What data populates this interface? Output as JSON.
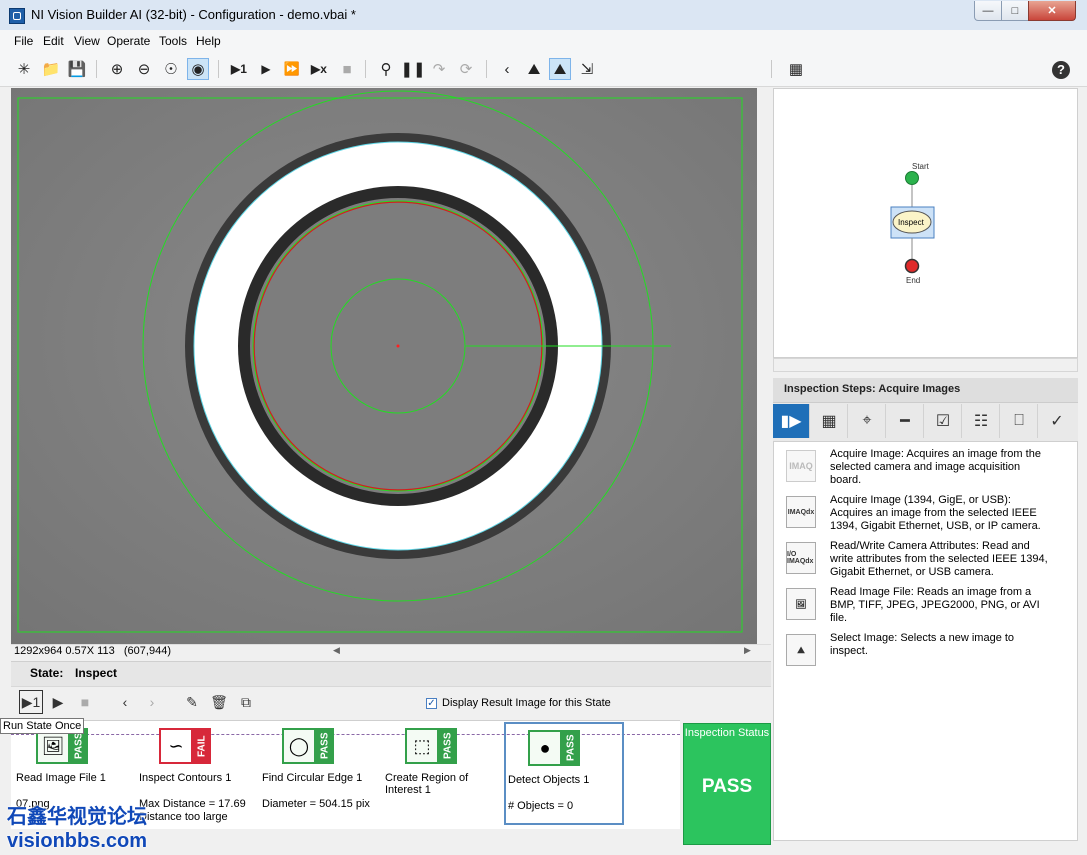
{
  "window": {
    "title": "NI Vision Builder AI (32-bit) - Configuration - demo.vbai *"
  },
  "menu": [
    "File",
    "Edit",
    "View",
    "Operate",
    "Tools",
    "Help"
  ],
  "toolbar": {
    "new_icon": "new-icon",
    "open_icon": "folder-icon",
    "save_icon": "save-icon",
    "zoom_in_icon": "zoom-in-icon",
    "zoom_out_icon": "zoom-out-icon",
    "zoom_11_icon": "zoom-1-1-icon",
    "zoom_fit_icon": "zoom-fit-icon",
    "run_once_glyph": "▶1",
    "run_glyph": "▶",
    "run_cont_glyph": "⏩",
    "run_x_glyph": "▶x"
  },
  "viewer": {
    "image_info": "1292x964 0.57X 113",
    "coords": "(607,944)"
  },
  "state": {
    "label": "State:",
    "value": "Inspect"
  },
  "display_result": {
    "checked": true,
    "label": "Display Result Image for this State"
  },
  "tooltip": "Run State Once",
  "steps": [
    {
      "name": "Read Image File 1",
      "status": "PASS",
      "result1": "07.png",
      "result2": ""
    },
    {
      "name": "Inspect Contours 1",
      "status": "FAIL",
      "result1": "Max Distance = 17.69",
      "result2": "Distance too large"
    },
    {
      "name": "Find Circular Edge 1",
      "status": "PASS",
      "result1": "Diameter = 504.15 pix",
      "result2": ""
    },
    {
      "name": "Create Region of Interest 1",
      "status": "PASS",
      "result1": "",
      "result2": ""
    },
    {
      "name": "Detect Objects 1",
      "status": "PASS",
      "result1": "# Objects = 0",
      "result2": ""
    }
  ],
  "inspection_status": {
    "title": "Inspection Status",
    "value": "PASS"
  },
  "flow": {
    "start_label": "Start",
    "inspect_label": "Inspect",
    "end_label": "End"
  },
  "inspection_steps": {
    "title": "Inspection Steps: Acquire Images",
    "items": [
      {
        "icon_text": "IMAQ",
        "text": "Acquire Image:  Acquires an image from the selected camera and image acquisition board."
      },
      {
        "icon_text": "IMAQdx",
        "text": "Acquire Image (1394, GigE, or USB):  Acquires an image from the selected IEEE 1394, Gigabit Ethernet, USB, or IP camera."
      },
      {
        "icon_text": "I/O IMAQdx",
        "text": "Read/Write Camera Attributes:  Read and write attributes from the selected IEEE 1394, Gigabit Ethernet, or USB camera."
      },
      {
        "icon_text": "",
        "text": "Read Image File:  Reads an image from a BMP, TIFF, JPEG, JPEG2000, PNG, or AVI file."
      },
      {
        "icon_text": "",
        "text": "Select Image:  Selects a new image to inspect."
      }
    ]
  },
  "watermark": {
    "line1": "石鑫华视觉论坛",
    "line2": "visionbbs.com"
  },
  "colors": {
    "pass": "#2cc45e",
    "fail": "#d7283a",
    "accent": "#1f6fb8",
    "overlay_green": "#22dd22"
  }
}
